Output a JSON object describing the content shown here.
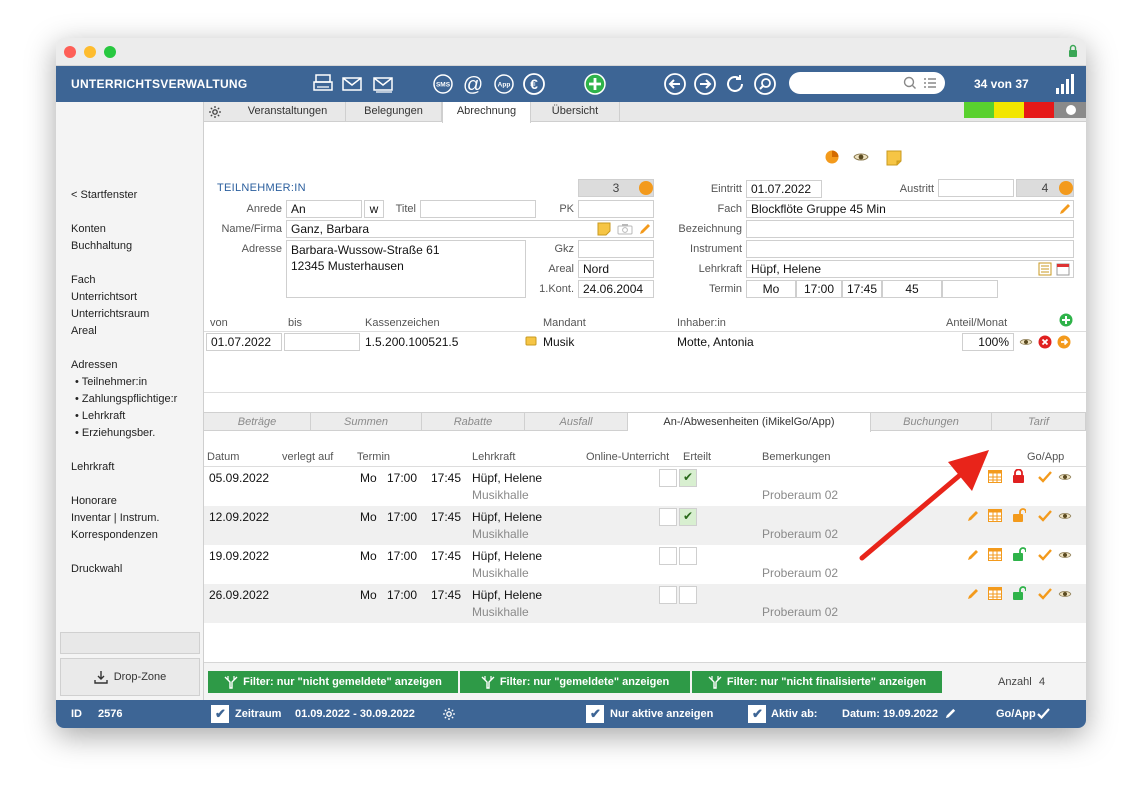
{
  "app": {
    "title": "UNTERRICHTSVERWALTUNG",
    "record_count": "34 von 37",
    "search_value": ""
  },
  "sidebar": {
    "back": "< Startfenster",
    "items": [
      "Konten",
      "Buchhaltung",
      "Fach",
      "Unterrichtsort",
      "Unterrichtsraum",
      "Areal",
      "Adressen"
    ],
    "sub_items": [
      "• Teilnehmer:in",
      "• Zahlungspflichtige:r",
      "• Lehrkraft",
      "• Erziehungsber."
    ],
    "items2": [
      "Lehrkraft",
      "Honorare",
      "Inventar | Instrum.",
      "Korrespondenzen",
      "Druckwahl"
    ],
    "drop_zone": "Drop-Zone"
  },
  "tabs": [
    "Veranstaltungen",
    "Belegungen",
    "Abrechnung",
    "Übersicht"
  ],
  "form": {
    "section": "TEILNEHMER:IN",
    "count": "3",
    "anrede_label": "Anrede",
    "anrede": "An",
    "anrede2": "w",
    "titel_label": "Titel",
    "titel": "",
    "pk_label": "PK",
    "pk": "",
    "name_label": "Name/Firma",
    "name": "Ganz, Barbara",
    "adresse_label": "Adresse",
    "adresse_line1": "Barbara-Wussow-Straße 61",
    "adresse_line2": "12345 Musterhausen",
    "gkz_label": "Gkz",
    "gkz": "",
    "areal_label": "Areal",
    "areal": "Nord",
    "kont_label": "1.Kont.",
    "kont": "24.06.2004",
    "eintritt_label": "Eintritt",
    "eintritt": "01.07.2022",
    "austritt_label": "Austritt",
    "austritt": "",
    "austritt_num": "4",
    "fach_label": "Fach",
    "fach": "Blockflöte Gruppe 45 Min",
    "bezeichnung_label": "Bezeichnung",
    "bezeichnung": "",
    "instrument_label": "Instrument",
    "instrument": "",
    "lehrkraft_label": "Lehrkraft",
    "lehrkraft": "Hüpf, Helene",
    "termin_label": "Termin",
    "termin_day": "Mo",
    "termin_from": "17:00",
    "termin_to": "17:45",
    "termin_min": "45"
  },
  "account": {
    "headers": [
      "von",
      "bis",
      "Kassenzeichen",
      "Mandant",
      "Inhaber:in",
      "Anteil/Monat"
    ],
    "row": {
      "von": "01.07.2022",
      "bis": "",
      "kassenzeichen": "1.5.200.100521.5",
      "mandant": "Musik",
      "inhaber": "Motte, Antonia",
      "anteil": "100%"
    }
  },
  "subtabs": [
    "Beträge",
    "Summen",
    "Rabatte",
    "Ausfall",
    "An-/Abwesenheiten (iMikelGo/App)",
    "Buchungen",
    "Tarif"
  ],
  "attendance": {
    "headers": [
      "Datum",
      "verlegt auf",
      "Termin",
      "Lehrkraft",
      "Online-Unterricht",
      "Erteilt",
      "Bemerkungen",
      "Go/App"
    ],
    "rows": [
      {
        "datum": "05.09.2022",
        "day": "Mo",
        "from": "17:00",
        "to": "17:45",
        "lehrkraft": "Hüpf, Helene",
        "ort": "Musikhalle",
        "bemerkung": "Proberaum 02",
        "erteilt": true,
        "locked": true
      },
      {
        "datum": "12.09.2022",
        "day": "Mo",
        "from": "17:00",
        "to": "17:45",
        "lehrkraft": "Hüpf, Helene",
        "ort": "Musikhalle",
        "bemerkung": "Proberaum 02",
        "erteilt": true,
        "locked": false
      },
      {
        "datum": "19.09.2022",
        "day": "Mo",
        "from": "17:00",
        "to": "17:45",
        "lehrkraft": "Hüpf, Helene",
        "ort": "Musikhalle",
        "bemerkung": "Proberaum 02",
        "erteilt": false,
        "locked": false
      },
      {
        "datum": "26.09.2022",
        "day": "Mo",
        "from": "17:00",
        "to": "17:45",
        "lehrkraft": "Hüpf, Helene",
        "ort": "Musikhalle",
        "bemerkung": "Proberaum 02",
        "erteilt": false,
        "locked": false
      }
    ]
  },
  "filters": [
    "Filter: nur \"nicht gemeldete\" anzeigen",
    "Filter: nur \"gemeldete\" anzeigen",
    "Filter: nur \"nicht finalisierte\" anzeigen"
  ],
  "anzahl_label": "Anzahl",
  "anzahl": "4",
  "status": {
    "id_label": "ID",
    "id": "2576",
    "zeitraum_label": "Zeitraum",
    "zeitraum": "01.09.2022  -  30.09.2022",
    "nur_aktive": "Nur aktive anzeigen",
    "aktiv_ab": "Aktiv ab:",
    "datum": "Datum: 19.09.2022",
    "goapp": "Go/App"
  },
  "colors": {
    "accent": "#3d6595",
    "filter": "#2e9a47",
    "orange": "#f39a1c",
    "arrow": "#e8241a"
  }
}
